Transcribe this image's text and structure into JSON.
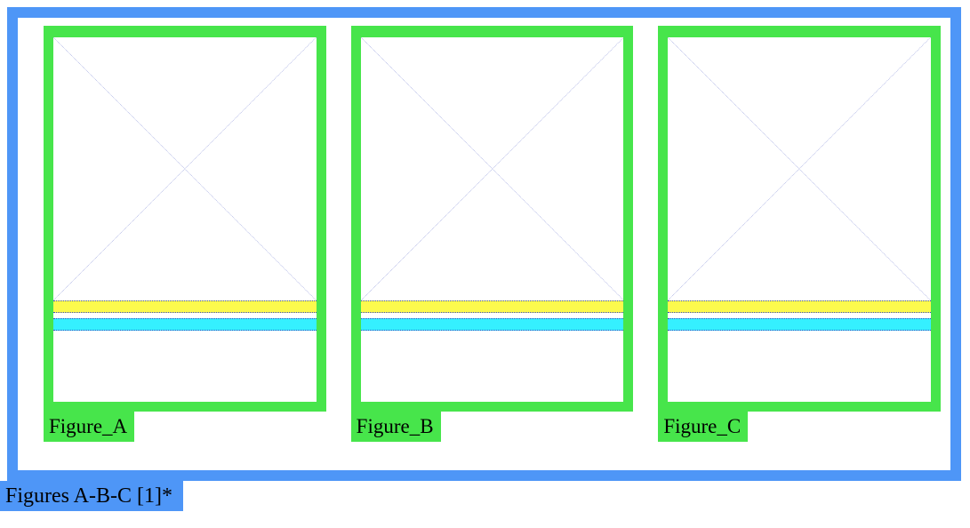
{
  "outer_label": "Figures A-B-C [1]*",
  "colors": {
    "outer_border": "#4e96f7",
    "card_border": "#47e54b",
    "band_yellow": "#fcfa4d",
    "band_cyan": "#35f0ff",
    "stroke": "#3b4cc0"
  },
  "panels": [
    {
      "label": "Figure_A"
    },
    {
      "label": "Figure_B"
    },
    {
      "label": "Figure_C"
    }
  ]
}
